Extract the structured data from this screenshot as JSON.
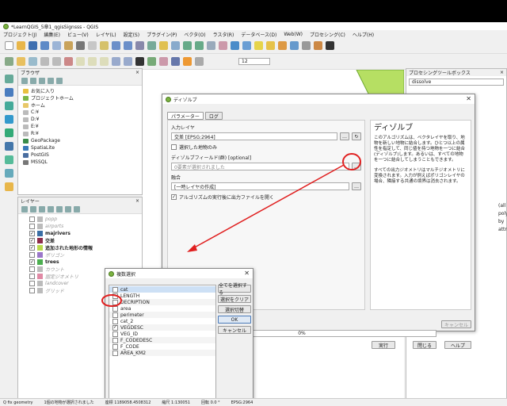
{
  "window": {
    "title": "*LearnQGIS_5章1_qgisSignsss - QGIS"
  },
  "menu": [
    "プロジェクト(J)",
    "編集(E)",
    "ビュー(V)",
    "レイヤ(L)",
    "設定(S)",
    "プラグイン(P)",
    "ベクタ(O)",
    "ラスタ(R)",
    "データベース(D)",
    "Web(W)",
    "プロセシング(C)",
    "ヘルプ(H)"
  ],
  "toolbar": {
    "scale_value": "12"
  },
  "browser": {
    "title": "ブラウザ",
    "items": [
      "お気に入り",
      "プロジェクトホーム",
      "ホーム",
      "C:¥",
      "D:¥",
      "E:¥",
      "R:¥",
      "GeoPackage",
      "SpatiaLite",
      "PostGIS",
      "MSSQL"
    ]
  },
  "layers": {
    "title": "レイヤー",
    "items": [
      {
        "name": "popp",
        "checked": false,
        "dim": true,
        "color": "#bbbbbb"
      },
      {
        "name": "airports",
        "checked": false,
        "dim": true,
        "color": "#bbbbbb"
      },
      {
        "name": "majrivers",
        "checked": true,
        "dim": false,
        "color": "#3a6ea5"
      },
      {
        "name": "交差",
        "checked": true,
        "dim": false,
        "color": "#8e2d4b"
      },
      {
        "name": "追加された地形の情報",
        "checked": true,
        "dim": false,
        "color": "#b9d94c"
      },
      {
        "name": "ポリゴン",
        "checked": false,
        "dim": true,
        "color": "#9a77c9"
      },
      {
        "name": "trees",
        "checked": true,
        "dim": false,
        "color": "#4caf50"
      },
      {
        "name": "カウント",
        "checked": false,
        "dim": true,
        "color": "#bbbbbb"
      },
      {
        "name": "固定ジオメトリ",
        "checked": false,
        "dim": true,
        "color": "#e08aa5"
      },
      {
        "name": "landcover",
        "checked": false,
        "dim": true,
        "color": "#bbbbbb"
      },
      {
        "name": "グリッド",
        "checked": false,
        "dim": true,
        "color": "#bbbbbb"
      }
    ]
  },
  "processing": {
    "title": "プロセシングツールボックス",
    "search": "dissolve",
    "side_text_1": "(all polygons)",
    "side_text_2": "by attribute)"
  },
  "dissolve_dialog": {
    "title": "ディゾルブ",
    "tab_params": "パラメーター",
    "tab_log": "ログ",
    "input_layer_label": "入力レイヤ",
    "input_layer_value": "交差 [EPSG:2964]",
    "selected_only_label": "選択した地物のみ",
    "dissolve_field_label": "ディゾルブフィールド(群) [optional]",
    "dissolve_field_value": "0要素が選択されました",
    "output_label": "融合",
    "output_value": "[一時レイヤの作成]",
    "open_output_label": "アルゴリズムの実行後に出力ファイルを開く",
    "progress_text": "0%",
    "help_title": "ディゾルブ",
    "help_p1": "このアルゴリズムは、ベクタレイヤを取り、地物を新しい地物に結合します。ひとつ以上の属性を指定して、同じ値を持つ地物を一つに結合(ディゾルブ)します。あるいは、すべての地物を一つに結合してしまうこともできます。",
    "help_p2": "すべての出力ジオメトリはマルチジオメトリに変換されます。入力が例えばポリゴンレイヤの場合、隣接する共通の境界は消去されます。",
    "cancel": "キャンセル",
    "run": "実行",
    "close": "閉じる",
    "help": "ヘルプ"
  },
  "multi_select": {
    "title": "複数選択",
    "fields": [
      {
        "name": "cat",
        "checked": false
      },
      {
        "name": "LENGTH",
        "checked": false
      },
      {
        "name": "DECRIPTION",
        "checked": false
      },
      {
        "name": "area",
        "checked": false
      },
      {
        "name": "perimeter",
        "checked": false
      },
      {
        "name": "cat_2",
        "checked": false
      },
      {
        "name": "VEGDESC",
        "checked": true
      },
      {
        "name": "VEG_ID",
        "checked": false
      },
      {
        "name": "F_CODEDESC",
        "checked": false
      },
      {
        "name": "F_CODE",
        "checked": false
      },
      {
        "name": "AREA_KM2",
        "checked": false
      }
    ],
    "select_all": "全てを選択する",
    "clear_selection": "選択をクリア",
    "toggle_selection": "選択切替",
    "ok": "OK",
    "cancel": "キャンセル"
  },
  "status": {
    "left": "Q  fix geometry",
    "msg": "1個の地物が選択されました",
    "coord_label": "座標",
    "coord": "1189058.4508312",
    "scale_label": "縮尺",
    "scale": "1:130051",
    "rotation_label": "回転",
    "rotation": "0.0 °",
    "crs": "EPSG:2964"
  },
  "colors": {
    "highlight_circle": "#e02020",
    "arrow": "#e02020",
    "map_green": "#b6df63"
  }
}
